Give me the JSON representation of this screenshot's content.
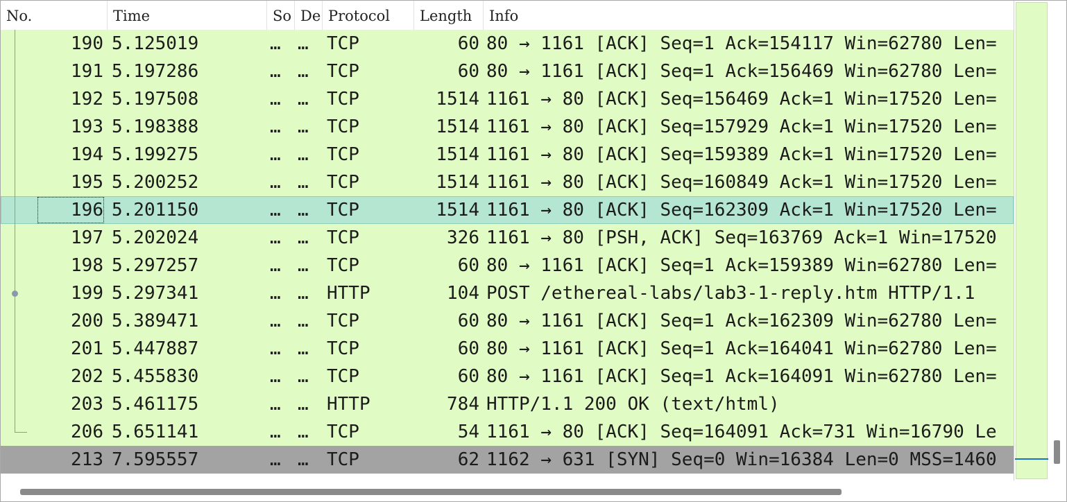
{
  "columns": {
    "no": "No.",
    "time": "Time",
    "source": "So",
    "destination": "De",
    "protocol": "Protocol",
    "length": "Length",
    "info": "Info"
  },
  "packets": [
    {
      "no": "190",
      "time": "5.125019",
      "src": "…",
      "dst": "…",
      "proto": "TCP",
      "len": "60",
      "info": "80 → 1161 [ACK] Seq=1 Ack=154117 Win=62780 Len="
    },
    {
      "no": "191",
      "time": "5.197286",
      "src": "…",
      "dst": "…",
      "proto": "TCP",
      "len": "60",
      "info": "80 → 1161 [ACK] Seq=1 Ack=156469 Win=62780 Len="
    },
    {
      "no": "192",
      "time": "5.197508",
      "src": "…",
      "dst": "…",
      "proto": "TCP",
      "len": "1514",
      "info": "1161 → 80 [ACK] Seq=156469 Ack=1 Win=17520 Len="
    },
    {
      "no": "193",
      "time": "5.198388",
      "src": "…",
      "dst": "…",
      "proto": "TCP",
      "len": "1514",
      "info": "1161 → 80 [ACK] Seq=157929 Ack=1 Win=17520 Len="
    },
    {
      "no": "194",
      "time": "5.199275",
      "src": "…",
      "dst": "…",
      "proto": "TCP",
      "len": "1514",
      "info": "1161 → 80 [ACK] Seq=159389 Ack=1 Win=17520 Len="
    },
    {
      "no": "195",
      "time": "5.200252",
      "src": "…",
      "dst": "…",
      "proto": "TCP",
      "len": "1514",
      "info": "1161 → 80 [ACK] Seq=160849 Ack=1 Win=17520 Len="
    },
    {
      "no": "196",
      "time": "5.201150",
      "src": "…",
      "dst": "…",
      "proto": "TCP",
      "len": "1514",
      "info": "1161 → 80 [ACK] Seq=162309 Ack=1 Win=17520 Len="
    },
    {
      "no": "197",
      "time": "5.202024",
      "src": "…",
      "dst": "…",
      "proto": "TCP",
      "len": "326",
      "info": "1161 → 80 [PSH, ACK] Seq=163769 Ack=1 Win=17520"
    },
    {
      "no": "198",
      "time": "5.297257",
      "src": "…",
      "dst": "…",
      "proto": "TCP",
      "len": "60",
      "info": "80 → 1161 [ACK] Seq=1 Ack=159389 Win=62780 Len="
    },
    {
      "no": "199",
      "time": "5.297341",
      "src": "…",
      "dst": "…",
      "proto": "HTTP",
      "len": "104",
      "info": "POST /ethereal-labs/lab3-1-reply.htm HTTP/1.1"
    },
    {
      "no": "200",
      "time": "5.389471",
      "src": "…",
      "dst": "…",
      "proto": "TCP",
      "len": "60",
      "info": "80 → 1161 [ACK] Seq=1 Ack=162309 Win=62780 Len="
    },
    {
      "no": "201",
      "time": "5.447887",
      "src": "…",
      "dst": "…",
      "proto": "TCP",
      "len": "60",
      "info": "80 → 1161 [ACK] Seq=1 Ack=164041 Win=62780 Len="
    },
    {
      "no": "202",
      "time": "5.455830",
      "src": "…",
      "dst": "…",
      "proto": "TCP",
      "len": "60",
      "info": "80 → 1161 [ACK] Seq=1 Ack=164091 Win=62780 Len="
    },
    {
      "no": "203",
      "time": "5.461175",
      "src": "…",
      "dst": "…",
      "proto": "HTTP",
      "len": "784",
      "info": "HTTP/1.1 200 OK  (text/html)"
    },
    {
      "no": "206",
      "time": "5.651141",
      "src": "…",
      "dst": "…",
      "proto": "TCP",
      "len": "54",
      "info": "1161 → 80 [ACK] Seq=164091 Ack=731 Win=16790 Le"
    },
    {
      "no": "213",
      "time": "7.595557",
      "src": "…",
      "dst": "…",
      "proto": "TCP",
      "len": "62",
      "info": "1162 → 631 [SYN] Seq=0 Win=16384 Len=0 MSS=1460"
    }
  ],
  "selected_packet": "196",
  "colors": {
    "tcp_row_bg": "#e0fcc4",
    "selected_row_bg": "#b4e6d2",
    "syn_row_bg": "#a3a3a3",
    "minimap_marker": "#1f6fc2"
  }
}
